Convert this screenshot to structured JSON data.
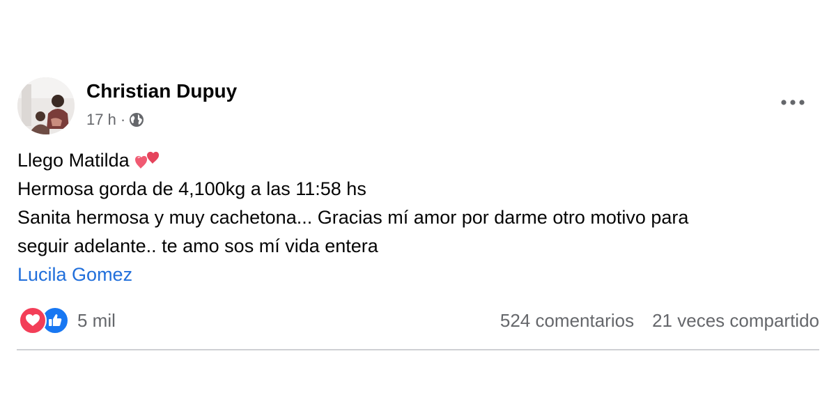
{
  "post": {
    "author": "Christian Dupuy",
    "time": "17 h",
    "separator": "·",
    "privacy_icon": "globe-icon",
    "options_icon": "more-options-icon",
    "lines": [
      "Llego Matilda",
      "Hermosa gorda de 4,100kg a las 11:58 hs",
      "Sanita hermosa y muy cachetona... Gracias mí amor por darme otro motivo para",
      "seguir adelante.. te amo sos mí vida entera"
    ],
    "emoji": "two-hearts-emoji",
    "mention": "Lucila Gomez"
  },
  "footer": {
    "reaction_icons": [
      "love-reaction-icon",
      "like-reaction-icon"
    ],
    "reaction_count": "5 mil",
    "comments": "524 comentarios",
    "shares": "21 veces compartido"
  },
  "colors": {
    "text": "#050505",
    "secondary": "#65676b",
    "link": "#216fdb",
    "love": "#f33e58",
    "like": "#1877f2",
    "divider": "#ced0d4"
  }
}
